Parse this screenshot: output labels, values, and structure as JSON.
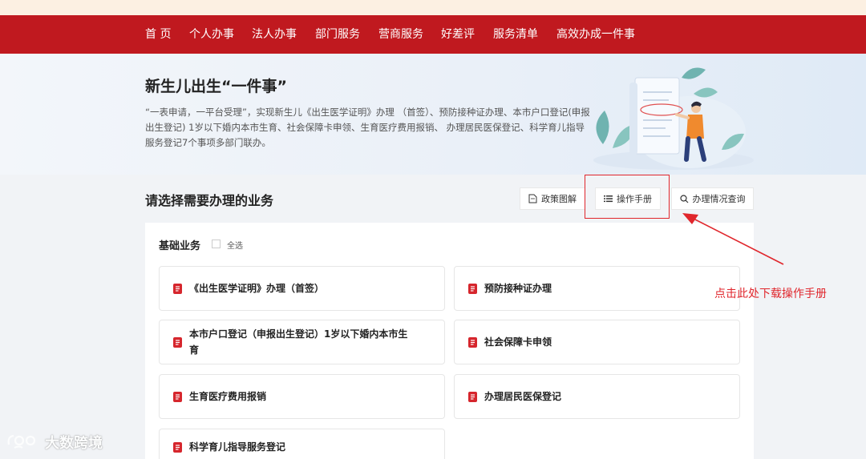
{
  "nav": {
    "items": [
      "首 页",
      "个人办事",
      "法人办事",
      "部门服务",
      "营商服务",
      "好差评",
      "服务清单",
      "高效办成一件事"
    ]
  },
  "hero": {
    "title": "新生儿出生“一件事”",
    "description": "“一表申请，一平台受理”，实现新生儿《出生医学证明》办理 （首签）、预防接种证办理、本市户口登记(申报出生登记) 1岁以下婚内本市生育、社会保障卡申领、生育医疗费用报销、 办理居民医保登记、科学育儿指导服务登记7个事项多部门联办。"
  },
  "section": {
    "title": "请选择需要办理的业务"
  },
  "toolbar": {
    "policy_label": "政策图解",
    "manual_label": "操作手册",
    "query_label": "办理情况查询"
  },
  "group": {
    "title": "基础业务",
    "select_all_label": "全选"
  },
  "cards": [
    "《出生医学证明》办理（首签）",
    "预防接种证办理",
    "本市户口登记（申报出生登记）1岁以下婚内本市生育",
    "社会保障卡申领",
    "生育医疗费用报销",
    "办理居民医保登记",
    "科学育儿指导服务登记"
  ],
  "annotation": {
    "text": "点击此处下载操作手册"
  },
  "watermark": {
    "text": "大数跨境"
  },
  "colors": {
    "brand_red": "#c0191f",
    "annotation_red": "#e0262c",
    "top_strip": "#fcf0e2"
  }
}
